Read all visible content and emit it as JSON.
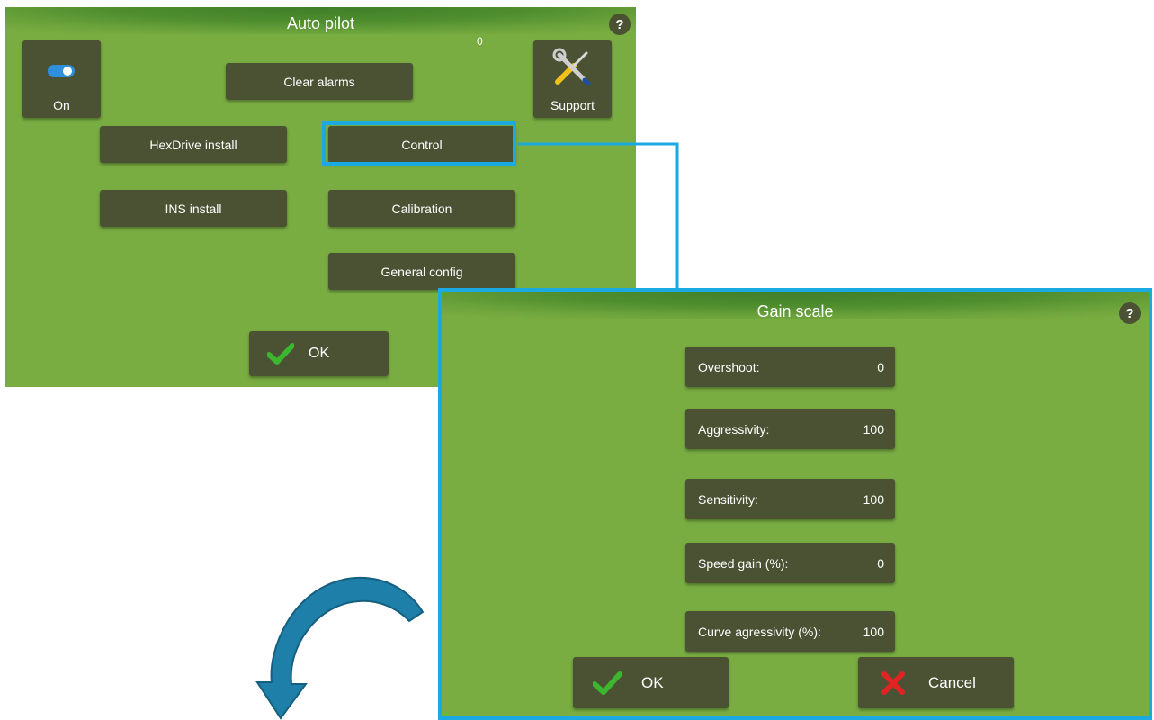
{
  "autopilot": {
    "title": "Auto pilot",
    "help": "?",
    "counter": "0",
    "toggle_label": "On",
    "support_label": "Support",
    "buttons": {
      "clear_alarms": "Clear alarms",
      "hexdrive_install": "HexDrive install",
      "control": "Control",
      "ins_install": "INS install",
      "calibration": "Calibration",
      "general_config": "General config",
      "ok": "OK"
    }
  },
  "gain_scale": {
    "title": "Gain scale",
    "help": "?",
    "fields": [
      {
        "label": "Overshoot:",
        "value": "0"
      },
      {
        "label": "Aggressivity:",
        "value": "100"
      },
      {
        "label": "Sensitivity:",
        "value": "100"
      },
      {
        "label": "Speed gain (%):",
        "value": "0"
      },
      {
        "label": "Curve agressivity (%):",
        "value": "100"
      }
    ],
    "ok": "OK",
    "cancel": "Cancel"
  },
  "colors": {
    "panel_bg": "#79ad42",
    "button_bg": "#4a5233",
    "highlight": "#1aa9e0",
    "arrow": "#1e7fa8",
    "ok_check": "#3cb52f",
    "cancel_x": "#e02424"
  },
  "icons": {
    "toggle": "toggle-switch-icon",
    "support": "tools-wrench-screwdriver-icon",
    "ok": "checkmark-icon",
    "cancel": "x-icon",
    "help": "question-mark-icon",
    "arrow": "curved-arrow-icon"
  }
}
